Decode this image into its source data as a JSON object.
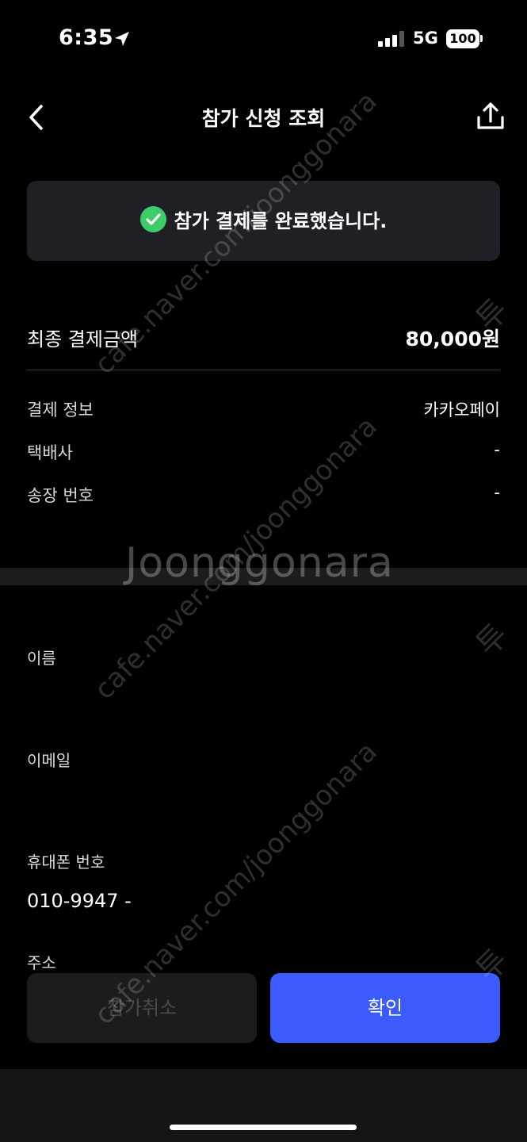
{
  "status_bar": {
    "time": "6:35",
    "network": "5G",
    "battery": "100"
  },
  "nav": {
    "title": "참가 신청 조회"
  },
  "banner": {
    "message": "참가 결제를 완료했습니다.",
    "icon": "check-circle-icon",
    "icon_color": "#3dcc6a"
  },
  "payment": {
    "total_label": "최종 결제금액",
    "total_value": "80,000원",
    "rows": [
      {
        "label": "결제 정보",
        "value": "카카오페이"
      },
      {
        "label": "택배사",
        "value": "-"
      },
      {
        "label": "송장 번호",
        "value": "-"
      }
    ]
  },
  "applicant": {
    "name_label": "이름",
    "email_label": "이메일",
    "phone_label": "휴대폰 번호",
    "phone_value": "010-9947 -",
    "address_label": "주소"
  },
  "buttons": {
    "cancel": "참가취소",
    "confirm": "확인"
  },
  "watermark": {
    "site": "cafe.naver.com/joonggonara",
    "brand": "Joonggonara",
    "side_text": "투"
  },
  "colors": {
    "accent": "#3b5bfd",
    "success": "#3dcc6a",
    "background": "#000000",
    "card": "#1e2026"
  }
}
